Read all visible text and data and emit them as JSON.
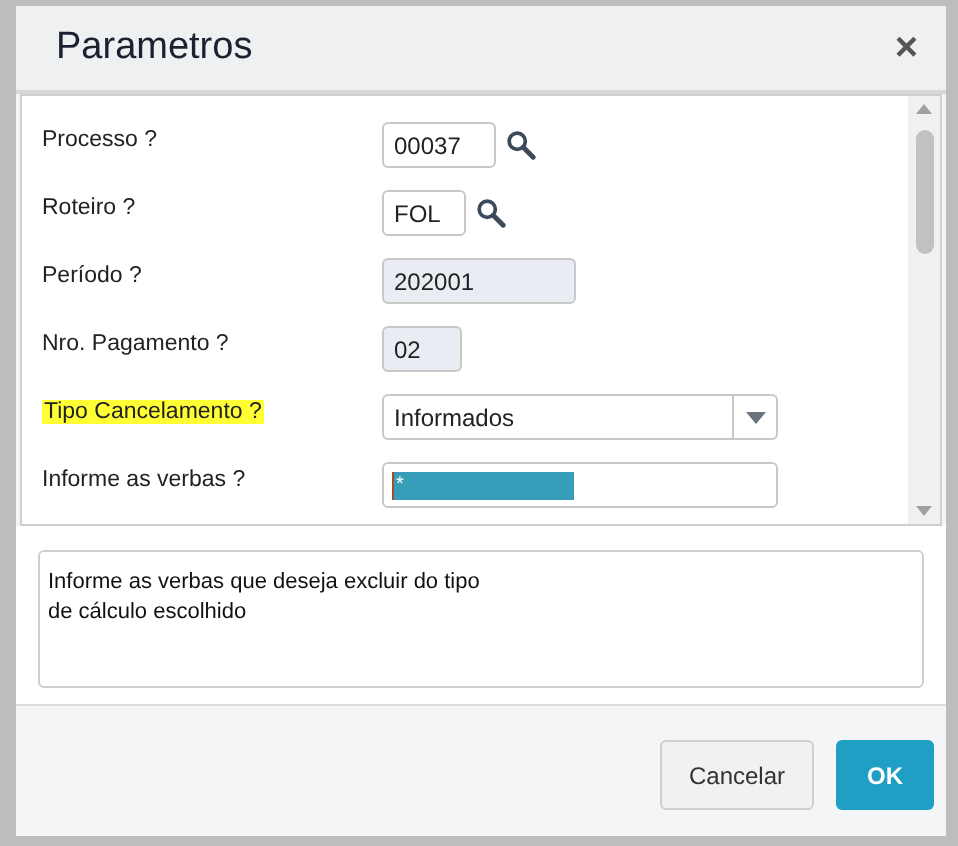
{
  "dialog": {
    "title": "Parametros",
    "close": "×"
  },
  "fields": [
    {
      "label": "Processo ?",
      "kind": "lookup",
      "value": "00037",
      "highlighted": false
    },
    {
      "label": "Roteiro ?",
      "kind": "lookup",
      "value": "FOL",
      "highlighted": false
    },
    {
      "label": "Período ?",
      "kind": "readonly",
      "value": "202001",
      "highlighted": false
    },
    {
      "label": "Nro. Pagamento ?",
      "kind": "readonly",
      "value": "02",
      "highlighted": false
    },
    {
      "label": "Tipo Cancelamento ?",
      "kind": "select",
      "value": "Informados",
      "highlighted": true
    },
    {
      "label": "Informe as verbas ?",
      "kind": "text",
      "value": "*",
      "highlighted": false,
      "selected": true
    }
  ],
  "help": "Informe as verbas que deseja excluir do tipo\nde cálculo escolhido",
  "buttons": [
    {
      "label": "Cancelar",
      "kind": "secondary"
    },
    {
      "label": "OK",
      "kind": "primary"
    }
  ]
}
